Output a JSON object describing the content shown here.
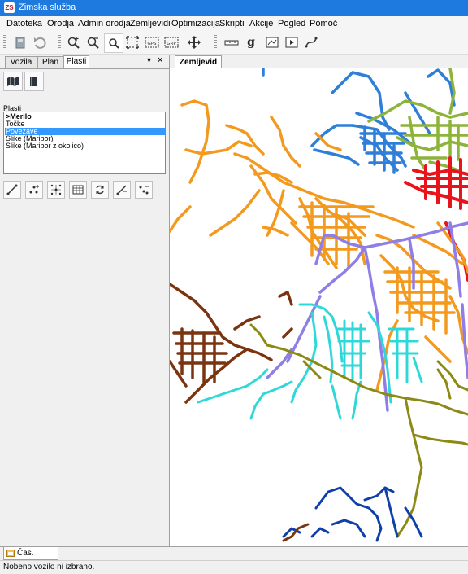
{
  "window": {
    "title": "Zimska služba",
    "app_icon_text": "ZS"
  },
  "menu": [
    "Datoteka",
    "Orodja",
    "Admin orodja",
    "Zemljevidi",
    "Optimizacija",
    "Skripti",
    "Akcije",
    "Pogled",
    "Pomoč"
  ],
  "toolbar": {
    "buttons": [
      "database-icon",
      "undo-icon",
      "zoom-in-icon",
      "zoom-out-icon",
      "zoom-box-icon",
      "zoom-extent-icon",
      "gps-icon",
      "grp-icon",
      "pan-icon",
      "ruler-icon",
      "g-icon",
      "map-doc-icon",
      "play-icon",
      "route-icon"
    ],
    "gps_label": "GPS",
    "grp_label": "GRP",
    "g_label": "g"
  },
  "left_panel": {
    "tabs": [
      "Vozila",
      "Plan",
      "Plasti"
    ],
    "active_tab": "Plasti",
    "dropdown_glyph": "▾",
    "close_glyph": "✕",
    "layers_label": "Plasti",
    "layers": [
      {
        "label": ">Merilo",
        "bold": true,
        "selected": false
      },
      {
        "label": "Točke",
        "bold": false,
        "selected": false
      },
      {
        "label": "Povezave",
        "bold": false,
        "selected": true
      },
      {
        "label": "Slike (Maribor)",
        "bold": false,
        "selected": false
      },
      {
        "label": "Slike (Maribor z okolico)",
        "bold": false,
        "selected": false
      }
    ]
  },
  "map_tab": {
    "label": "Zemljevid"
  },
  "bottom_tab": {
    "label": "Čas. interval"
  },
  "status": {
    "text": "Nobeno vozilo ni izbrano."
  },
  "colors": {
    "titlebar": "#1f7ae0",
    "selection": "#3399ff",
    "road_blue": "#2f7fd8",
    "road_green": "#8db43a",
    "road_red": "#e8141c",
    "road_orange": "#f39a1e",
    "road_purple": "#8f7ee8",
    "road_cyan": "#2fd8d8",
    "road_brown": "#7a3410",
    "road_olive": "#8c8a14",
    "road_navy": "#0f3fa8"
  }
}
